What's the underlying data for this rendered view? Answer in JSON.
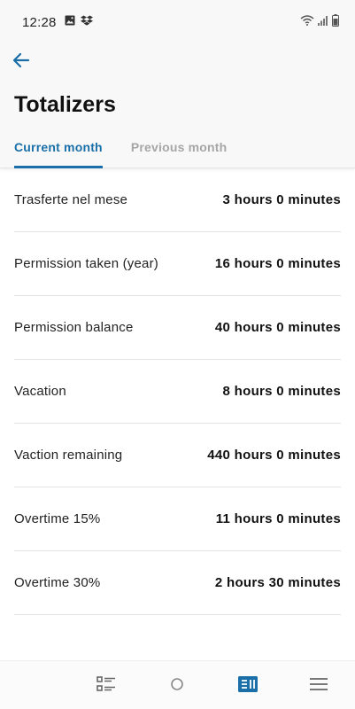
{
  "status_bar": {
    "time": "12:28",
    "left_icons": [
      "image-icon",
      "dropbox-icon"
    ],
    "right_icons": [
      "wifi-icon",
      "signal-icon",
      "battery-icon"
    ]
  },
  "header": {
    "back_icon": "arrow-left-icon",
    "title": "Totalizers",
    "tabs": [
      {
        "label": "Current month",
        "active": true
      },
      {
        "label": "Previous month",
        "active": false
      }
    ]
  },
  "totals": [
    {
      "label": "Trasferte nel mese",
      "value": "3 hours 0 minutes"
    },
    {
      "label": "Permission taken (year)",
      "value": "16 hours 0 minutes"
    },
    {
      "label": "Permission balance",
      "value": "40 hours 0 minutes"
    },
    {
      "label": "Vacation",
      "value": "8 hours 0 minutes"
    },
    {
      "label": "Vaction remaining",
      "value": "440 hours 0 minutes"
    },
    {
      "label": "Overtime 15%",
      "value": "11 hours 0 minutes"
    },
    {
      "label": "Overtime 30%",
      "value": "2 hours 30 minutes"
    }
  ],
  "bottom_nav": {
    "items": [
      "recent-apps-icon",
      "home-icon",
      "totalizers-icon",
      "menu-icon"
    ],
    "active": "totalizers-icon"
  },
  "colors": {
    "accent": "#1a6fa8",
    "inactive_tab": "#a6a6a6",
    "header_bg": "#f8f8f8",
    "divider": "#e2e2e2"
  }
}
